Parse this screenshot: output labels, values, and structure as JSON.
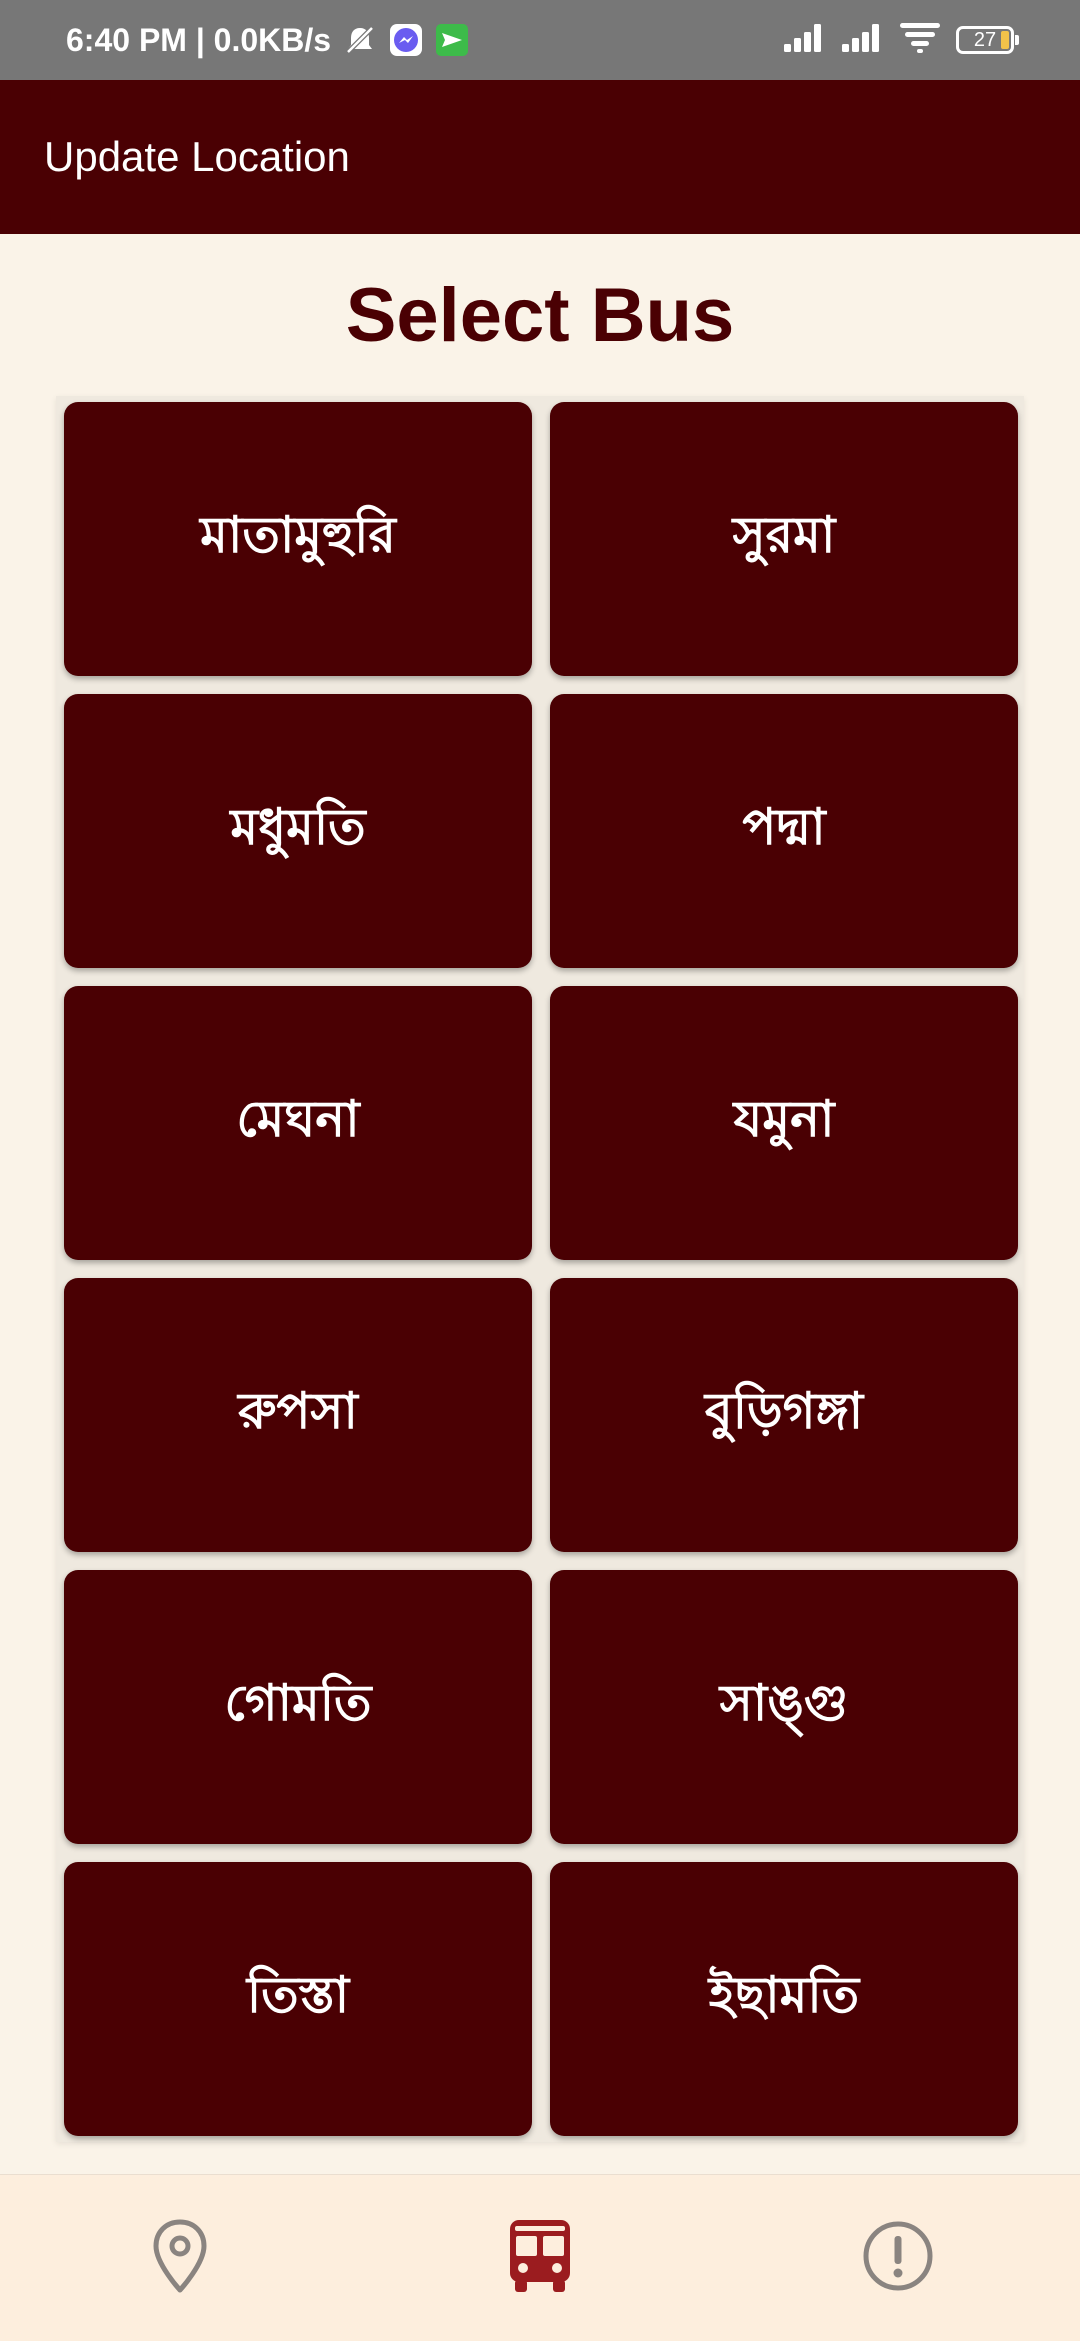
{
  "status_bar": {
    "time_speed": "6:40 PM | 0.0KB/s",
    "battery_level": "27",
    "icons": [
      "mute-icon",
      "messenger-icon",
      "message-icon",
      "signal-icon",
      "signal-icon",
      "wifi-icon",
      "battery-icon"
    ]
  },
  "app_bar": {
    "title": "Update Location"
  },
  "page": {
    "title": "Select Bus"
  },
  "buses": [
    {
      "label": "মাতামুহুরি"
    },
    {
      "label": "সুরমা"
    },
    {
      "label": "মধুমতি"
    },
    {
      "label": "পদ্মা"
    },
    {
      "label": "মেঘনা"
    },
    {
      "label": "যমুনা"
    },
    {
      "label": "রুপসা"
    },
    {
      "label": "বুড়িগঙ্গা"
    },
    {
      "label": "গোমতি"
    },
    {
      "label": "সাঙ্গু"
    },
    {
      "label": "তিস্তা"
    },
    {
      "label": "ইছামতি"
    }
  ],
  "bottom_nav": {
    "items": [
      {
        "icon": "location-pin-icon",
        "active": false
      },
      {
        "icon": "bus-icon",
        "active": true
      },
      {
        "icon": "alert-icon",
        "active": false
      }
    ]
  },
  "colors": {
    "primary": "#4a0003",
    "background": "#faf3e8",
    "nav_background": "#fdeedd",
    "nav_inactive": "#8a8480",
    "status_bar": "#777777"
  }
}
